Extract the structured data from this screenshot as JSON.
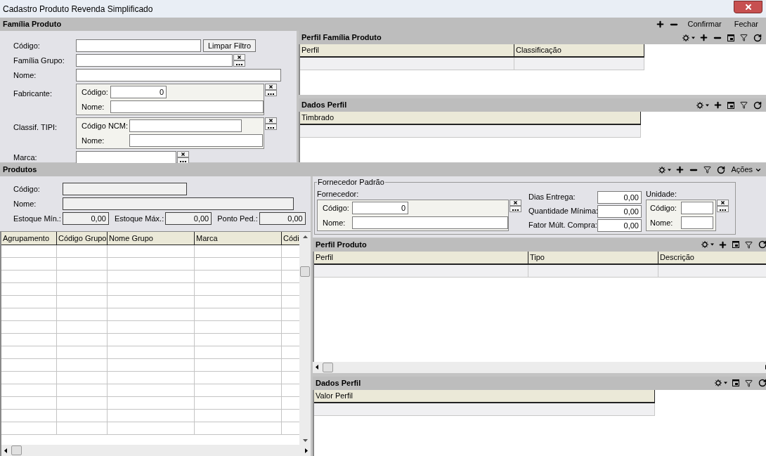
{
  "window": {
    "title": "Cadastro Produto Revenda Simplificado"
  },
  "familia_produto": {
    "title": "Família Produto",
    "toolbar": [
      {
        "kind": "add"
      },
      {
        "kind": "remove"
      },
      {
        "kind": "text",
        "label": "Confirmar"
      },
      {
        "kind": "text",
        "label": "Fechar"
      }
    ],
    "fields": [
      {
        "kind": "text",
        "label": "Código:",
        "button": "Limpar Filtro"
      },
      {
        "kind": "lookup",
        "label": "Família Grupo:"
      },
      {
        "kind": "text",
        "label": "Nome:"
      },
      {
        "kind": "group",
        "label": "Fabricante:",
        "subfields": [
          {
            "label": "Código:",
            "value": "0"
          },
          {
            "label": "Nome:"
          }
        ]
      },
      {
        "kind": "group",
        "label": "Classif. TIPI:",
        "subfields": [
          {
            "label": "Código NCM:"
          },
          {
            "label": "Nome:"
          }
        ]
      },
      {
        "kind": "lookup",
        "label": "Marca:"
      }
    ]
  },
  "perfil_familia_produto": {
    "title": "Perfil Família Produto",
    "toolbar": [
      {
        "kind": "view"
      },
      {
        "kind": "add"
      },
      {
        "kind": "remove"
      },
      {
        "kind": "window"
      },
      {
        "kind": "filter"
      },
      {
        "kind": "refresh"
      }
    ],
    "columns": [
      "Perfil",
      "Classificação"
    ]
  },
  "dados_perfil_familia": {
    "title": "Dados Perfil",
    "toolbar": [
      {
        "kind": "view"
      },
      {
        "kind": "add"
      },
      {
        "kind": "window"
      },
      {
        "kind": "filter"
      },
      {
        "kind": "refresh"
      }
    ],
    "columns": [
      "Timbrado"
    ]
  },
  "produtos": {
    "title": "Produtos",
    "toolbar": [
      {
        "kind": "view"
      },
      {
        "kind": "add"
      },
      {
        "kind": "remove"
      },
      {
        "kind": "filter"
      },
      {
        "kind": "refresh"
      },
      {
        "kind": "menu",
        "label": "Ações"
      }
    ],
    "codigo": {
      "label": "Código:",
      "disabled": true
    },
    "nome": {
      "label": "Nome:",
      "disabled": true
    },
    "estoque": [
      {
        "label": "Estoque Mín.:",
        "value": "0,00",
        "disabled": true
      },
      {
        "label": "Estoque Máx.:",
        "value": "0,00",
        "disabled": true
      },
      {
        "label": "Ponto Ped.:",
        "value": "0,00",
        "disabled": true
      }
    ],
    "grid": {
      "columns": [
        "Agrupamento",
        "Código Grupo",
        "Nome Grupo",
        "Marca",
        "Códi"
      ]
    }
  },
  "fornecedor_padrao": {
    "title": "Fornecedor Padrão",
    "fornecedor_label": "Fornecedor:",
    "fornecedor": [
      {
        "label": "Código:",
        "value": "0"
      },
      {
        "label": "Nome:"
      }
    ],
    "quantities": [
      {
        "label": "Dias Entrega:",
        "value": "0,00"
      },
      {
        "label": "Quantidade Mínima:",
        "value": "0,00"
      },
      {
        "label": "Fator Múlt. Compra:",
        "value": "0,00"
      }
    ],
    "unidade_label": "Unidade:",
    "unidade": [
      {
        "label": "Código:"
      },
      {
        "label": "Nome:"
      }
    ]
  },
  "perfil_produto": {
    "title": "Perfil Produto",
    "toolbar": [
      {
        "kind": "view"
      },
      {
        "kind": "add"
      },
      {
        "kind": "window"
      },
      {
        "kind": "filter"
      },
      {
        "kind": "refresh"
      }
    ],
    "columns": [
      "Perfil",
      "Tipo",
      "Descrição"
    ]
  },
  "dados_perfil_produto": {
    "title": "Dados Perfil",
    "toolbar": [
      {
        "kind": "view"
      },
      {
        "kind": "window"
      },
      {
        "kind": "filter"
      },
      {
        "kind": "refresh"
      }
    ],
    "columns": [
      "Valor Perfil"
    ]
  }
}
